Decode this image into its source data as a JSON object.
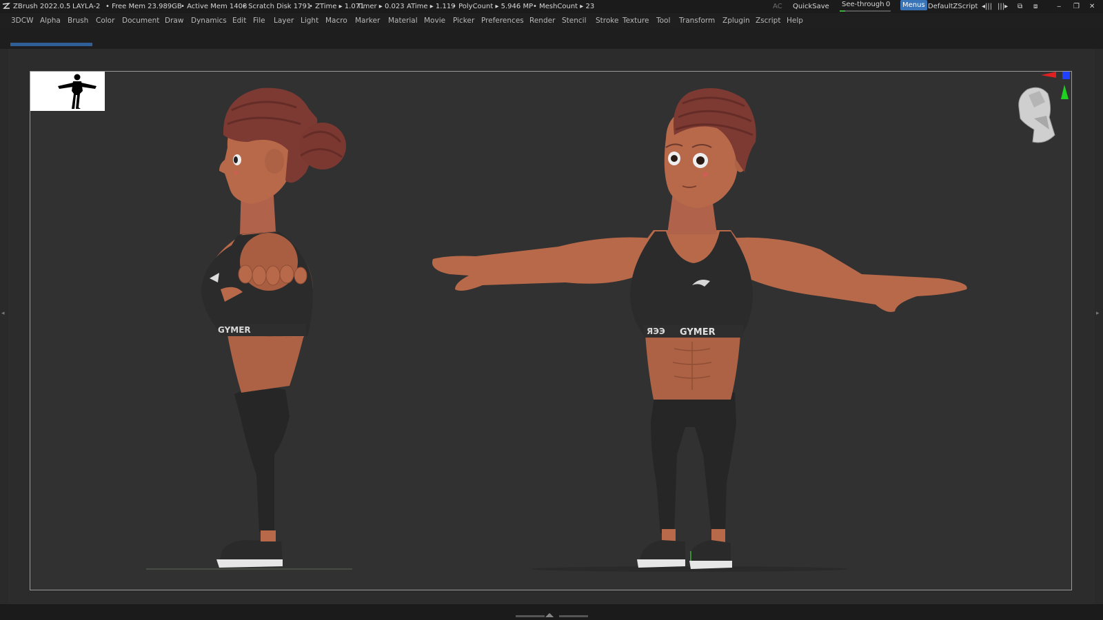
{
  "titlebar": {
    "app": "ZBrush 2022.0.5",
    "document": "LAYLA-2",
    "free_mem": "• Free Mem 23.989GB",
    "active_mem": "• Active Mem 1408",
    "scratch_disk": "• Scratch Disk 1791",
    "ztime": "• ZTime ▸ 1.071",
    "timer": "Timer ▸ 0.023",
    "atime": "ATime ▸ 1.119",
    "polycount": "• PolyCount ▸ 5.946 MP",
    "meshcount": "• MeshCount ▸ 23",
    "ac": "AC",
    "quicksave": "QuickSave",
    "see_through_label": "See-through",
    "see_through_value": "0",
    "menus": "Menus",
    "default_zscript": "DefaultZScript"
  },
  "menubar": {
    "items": [
      "3DCW",
      "Alpha",
      "Brush",
      "Color",
      "Document",
      "Draw",
      "Dynamics",
      "Edit",
      "File",
      "Layer",
      "Light",
      "Macro",
      "Marker",
      "Material",
      "Movie",
      "Picker",
      "Preferences",
      "Render",
      "Stencil",
      "Stroke",
      "Texture",
      "Tool",
      "Transform",
      "Zplugin",
      "Zscript",
      "Help"
    ]
  },
  "model": {
    "top_text": "GYMER",
    "top_text_side": "GYMER",
    "top_text_prefix": "ЯЭЭ"
  },
  "colors": {
    "skin": "#b5694a",
    "hair": "#7c3a33",
    "clothing": "#2a2a2a",
    "canvas": "#313131",
    "accent": "#3a74b8"
  }
}
